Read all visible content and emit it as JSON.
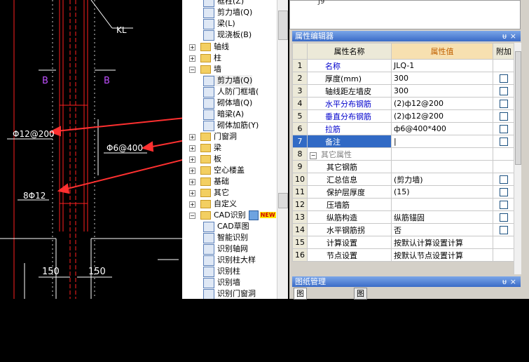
{
  "cad": {
    "labels": {
      "kl": "KL",
      "b_left": "B",
      "b_right": "B",
      "rebar1": "Φ12@200",
      "rebar2": "Φ6@400",
      "rebar3": "8Φ12",
      "dim1": "150",
      "dim2": "150"
    },
    "colors": {
      "wall": "#ff2020",
      "dim": "#ffffff",
      "label": "#ffffff",
      "b_label": "#c050ff",
      "arrow": "#ff3030"
    }
  },
  "tree": {
    "items": [
      {
        "label": "框柱(Z)",
        "icon": "column-icon"
      },
      {
        "label": "剪力墙(Q)",
        "icon": "wall-icon"
      },
      {
        "label": "梁(L)",
        "icon": "beam-icon"
      },
      {
        "label": "现浇板(B)",
        "icon": "slab-icon"
      },
      {
        "label": "轴线",
        "icon": "folder-icon",
        "expander": "+"
      },
      {
        "label": "柱",
        "icon": "folder-icon",
        "expander": "+"
      },
      {
        "label": "墙",
        "icon": "folder-open-icon",
        "expander": "−"
      },
      {
        "label": "剪力墙(Q)",
        "icon": "wall-icon"
      },
      {
        "label": "人防门框墙(",
        "icon": "door-frame-icon"
      },
      {
        "label": "砌体墙(Q)",
        "icon": "masonry-wall-icon"
      },
      {
        "label": "暗梁(A)",
        "icon": "hidden-beam-icon"
      },
      {
        "label": "砌体加筋(Y)",
        "icon": "masonry-rebar-icon"
      },
      {
        "label": "门窗洞",
        "icon": "folder-icon",
        "expander": "+"
      },
      {
        "label": "梁",
        "icon": "folder-icon",
        "expander": "+"
      },
      {
        "label": "板",
        "icon": "folder-icon",
        "expander": "+"
      },
      {
        "label": "空心楼盖",
        "icon": "folder-icon",
        "expander": "+"
      },
      {
        "label": "基础",
        "icon": "folder-icon",
        "expander": "+"
      },
      {
        "label": "其它",
        "icon": "folder-icon",
        "expander": "+"
      },
      {
        "label": "自定义",
        "icon": "folder-icon",
        "expander": "+"
      },
      {
        "label": "CAD识别",
        "icon": "folder-open-icon",
        "expander": "−",
        "badge": "NEW"
      },
      {
        "label": "CAD草图",
        "icon": "cad-icon"
      },
      {
        "label": "智能识别",
        "icon": "smart-icon"
      },
      {
        "label": "识别轴网",
        "icon": "axis-icon"
      },
      {
        "label": "识别柱大样",
        "icon": "column-detail-icon"
      },
      {
        "label": "识别柱",
        "icon": "column-icon"
      },
      {
        "label": "识别墙",
        "icon": "wall-icon"
      },
      {
        "label": "识别门窗洞",
        "icon": "door-icon"
      }
    ]
  },
  "top_window": {
    "label": "J9"
  },
  "property_editor": {
    "title": "属性编辑器",
    "pin": "ᵾ",
    "close": "×",
    "headers": {
      "name": "属性名称",
      "value": "属性值",
      "extra": "附加"
    },
    "rows": [
      {
        "num": "1",
        "name": "名称",
        "value": "JLQ-1",
        "style": "blue",
        "check": false
      },
      {
        "num": "2",
        "name": "厚度(mm)",
        "value": "300",
        "style": "",
        "check": true
      },
      {
        "num": "3",
        "name": "轴线距左墙皮",
        "value": "300",
        "style": "",
        "check": true
      },
      {
        "num": "4",
        "name": "水平分布钢筋",
        "value": "(2)ф12@200",
        "style": "blue",
        "check": true
      },
      {
        "num": "5",
        "name": "垂直分布钢筋",
        "value": "(2)ф12@200",
        "style": "blue",
        "check": true
      },
      {
        "num": "6",
        "name": "拉筋",
        "value": "ф6@400*400",
        "style": "blue",
        "check": true
      },
      {
        "num": "7",
        "name": "备注",
        "value": "|",
        "style": "sel",
        "check": true
      },
      {
        "num": "8",
        "name": "其它属性",
        "value": "",
        "style": "gray",
        "expander": "−",
        "check": false
      },
      {
        "num": "9",
        "name": "其它钢筋",
        "value": "",
        "style": "indent",
        "check": false
      },
      {
        "num": "10",
        "name": "汇总信息",
        "value": "(剪力墙)",
        "style": "indent",
        "check": true
      },
      {
        "num": "11",
        "name": "保护层厚度",
        "value": "(15)",
        "style": "indent",
        "check": true
      },
      {
        "num": "12",
        "name": "压墙筋",
        "value": "",
        "style": "indent",
        "check": true
      },
      {
        "num": "13",
        "name": "纵筋构造",
        "value": "纵筋锚固",
        "style": "indent",
        "check": true
      },
      {
        "num": "14",
        "name": "水平钢筋拐",
        "value": "否",
        "style": "indent",
        "check": true
      },
      {
        "num": "15",
        "name": "计算设置",
        "value": "按默认计算设置计算",
        "style": "indent",
        "check": false
      },
      {
        "num": "16",
        "name": "节点设置",
        "value": "按默认节点设置计算",
        "style": "indent",
        "check": false
      }
    ]
  },
  "drawing_manager": {
    "title": "图纸管理",
    "pin": "ᵾ",
    "close": "×",
    "tabs": [
      "图纸文件列表",
      "图纸楼层对照表"
    ]
  }
}
